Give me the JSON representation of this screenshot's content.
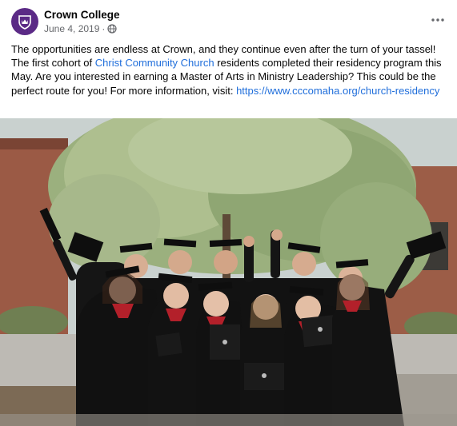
{
  "post": {
    "author": "Crown College",
    "date": "June 4, 2019",
    "separator": "·",
    "audience_icon": "globe-icon",
    "more_icon": "more-options-icon",
    "caption": {
      "part1": "The opportunities are endless at Crown, and they continue even after the turn of your tassel! The first cohort of ",
      "link1": "Christ Community Church",
      "part2": " residents completed their residency program this May. Are you interested in earning a Master of Arts in Ministry Leadership? This could be the perfect route for you! For more information, visit: ",
      "link2": "https://www.cccomaha.org/church-residency"
    },
    "photo_icon": "graduation-group-photo",
    "colors": {
      "avatar_bg": "#5b2a86",
      "link": "#216fdb",
      "meta_text": "#65676b",
      "gown": "#111111",
      "stole": "#b3202a"
    }
  }
}
